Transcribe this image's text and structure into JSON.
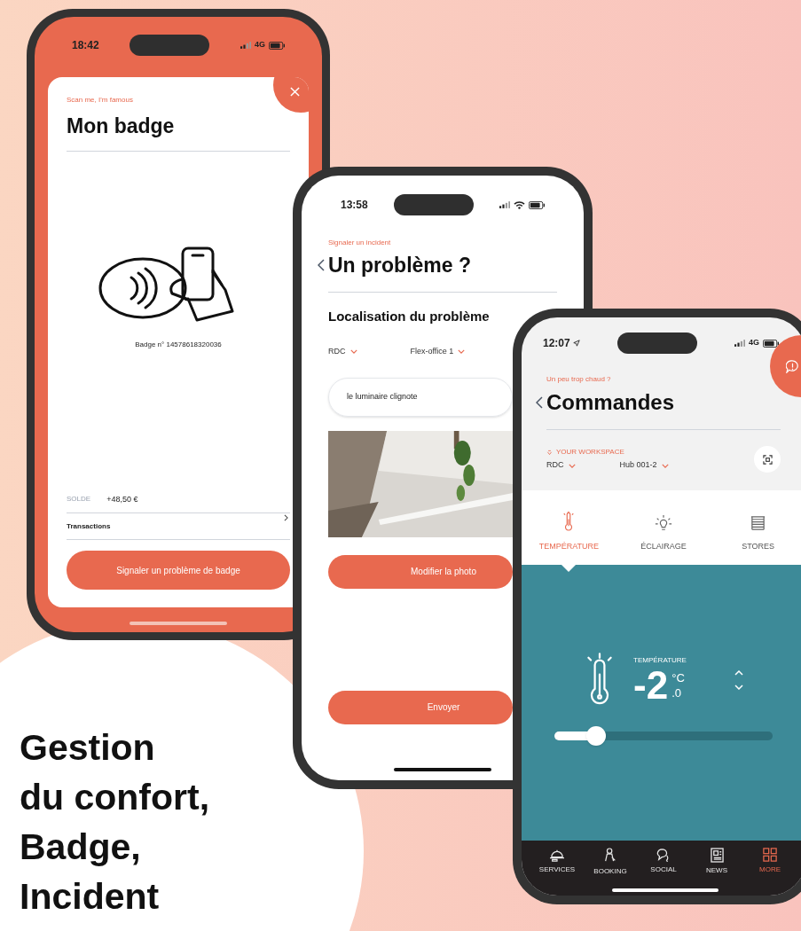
{
  "headline": "Gestion\ndu confort,\nBadge,\nIncident",
  "badge_phone": {
    "time": "18:42",
    "network": "4G",
    "subtitle": "Scan me, I'm famous",
    "title": "Mon badge",
    "badge_number": "Badge n° 14578618320036",
    "balance_label": "SOLDE",
    "balance": "+48,50 €",
    "transactions": "Transactions",
    "button": "Signaler un problème de badge"
  },
  "incident_phone": {
    "time": "13:58",
    "subtitle": "Signaler un incident",
    "title": "Un problème ?",
    "section": "Localisation du problème",
    "dropdowns": [
      "RDC",
      "Flex-office 1"
    ],
    "description": "le luminaire clignote",
    "buttons": [
      "Modifier la photo",
      "Envoyer"
    ]
  },
  "controls_phone": {
    "time": "12:07",
    "network": "4G",
    "subtitle": "Un peu trop chaud ?",
    "title": "Commandes",
    "workspace_label": "YOUR WORKSPACE",
    "dropdowns": [
      "RDC",
      "Hub 001-2"
    ],
    "tabs": [
      {
        "label": "TEMPÉRATURE",
        "selected": true
      },
      {
        "label": "ÉCLAIRAGE",
        "selected": false
      },
      {
        "label": "STORES",
        "selected": false
      }
    ],
    "temperature": {
      "label": "TEMPÉRATURE",
      "value": "-2",
      "unit": "°C",
      "decimal": ".0",
      "level": 0.19
    },
    "nav": [
      {
        "label": "SERVICES",
        "selected": false
      },
      {
        "label": "BOOKING",
        "selected": false
      },
      {
        "label": "SOCIAL",
        "selected": false
      },
      {
        "label": "NEWS",
        "selected": false
      },
      {
        "label": "MORE",
        "selected": true
      }
    ]
  }
}
